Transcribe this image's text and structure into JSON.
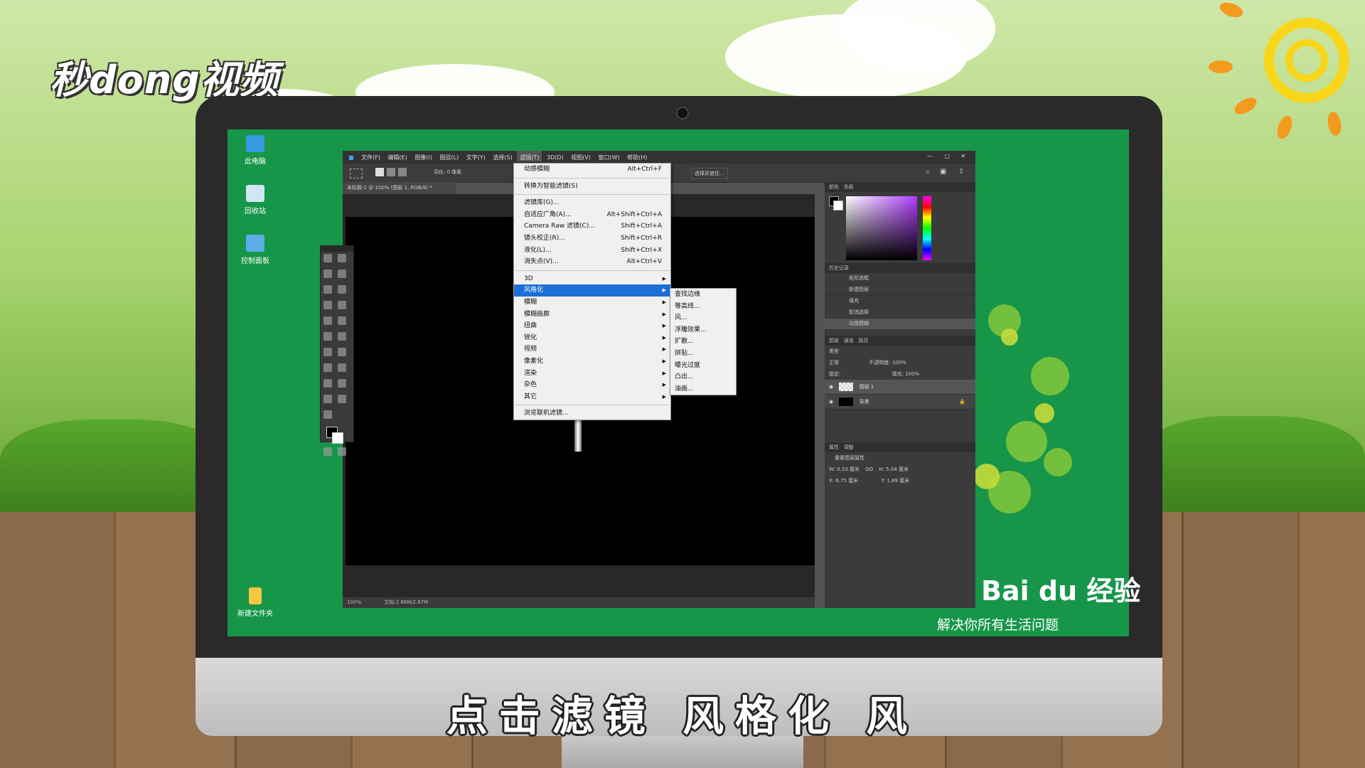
{
  "branding": {
    "logo_text": "秒dong视频",
    "baidu_logo": "Bai du 经验",
    "baidu_slogan": "解决你所有生活问题"
  },
  "subtitle": "点击滤镜 风格化 风",
  "desktop": {
    "icons": [
      {
        "label": "此电脑",
        "icon": "computer-icon"
      },
      {
        "label": "回收站",
        "icon": "recycle-bin-icon"
      },
      {
        "label": "控制面板",
        "icon": "control-panel-icon"
      },
      {
        "label": "新建文件夹",
        "icon": "folder-icon"
      }
    ]
  },
  "photoshop": {
    "menubar": [
      "文件(F)",
      "编辑(E)",
      "图像(I)",
      "图层(L)",
      "文字(Y)",
      "选择(S)",
      "滤镜(T)",
      "3D(D)",
      "视图(V)",
      "窗口(W)",
      "帮助(H)"
    ],
    "window_controls": [
      "—",
      "□",
      "✕"
    ],
    "options": {
      "feather": "羽化: 0 像素",
      "select_mask": "选择并遮住..."
    },
    "doc_tab": "未标题-1 @ 100% (图层 1, RGB/8) *",
    "status": {
      "zoom": "100%",
      "doc_size": "文档:2.86M/2.67M"
    },
    "panels": {
      "color_tabs": [
        "颜色",
        "色板"
      ],
      "history_title": "历史记录",
      "history_items": [
        "矩形选框",
        "新建图层",
        "填充",
        "取消选择",
        "动感模糊"
      ],
      "layers_tabs": [
        "图层",
        "通道",
        "路径"
      ],
      "layers_kind": "类型",
      "blend_mode": "正常",
      "opacity": "不透明度: 100%",
      "lock": "锁定:",
      "fill": "填充: 100%",
      "layers": [
        {
          "name": "图层 1"
        },
        {
          "name": "背景"
        }
      ],
      "properties_tabs": [
        "属性",
        "调整"
      ],
      "properties_title": "像素图层属性",
      "prop_w": "W: 0.33 厘米",
      "prop_h": "H: 5.04 厘米",
      "prop_x": "X: 6.75 厘米",
      "prop_y": "Y: 1.89 厘米",
      "link": "GO"
    },
    "filter_menu": {
      "top": [
        {
          "label": "动感模糊",
          "shortcut": "Alt+Ctrl+F"
        }
      ],
      "group2": [
        {
          "label": "转换为智能滤镜(S)",
          "shortcut": ""
        }
      ],
      "group3": [
        {
          "label": "滤镜库(G)...",
          "shortcut": ""
        },
        {
          "label": "自适应广角(A)...",
          "shortcut": "Alt+Shift+Ctrl+A"
        },
        {
          "label": "Camera Raw 滤镜(C)...",
          "shortcut": "Shift+Ctrl+A"
        },
        {
          "label": "镜头校正(R)...",
          "shortcut": "Shift+Ctrl+R"
        },
        {
          "label": "液化(L)...",
          "shortcut": "Shift+Ctrl+X"
        },
        {
          "label": "消失点(V)...",
          "shortcut": "Alt+Ctrl+V"
        }
      ],
      "submenus": [
        "3D",
        "风格化",
        "模糊",
        "模糊画廊",
        "扭曲",
        "锐化",
        "视频",
        "像素化",
        "渲染",
        "杂色",
        "其它"
      ],
      "highlighted": "风格化",
      "bottom": "浏览联机滤镜..."
    },
    "stylize_menu": [
      "查找边缘",
      "等高线...",
      "风...",
      "浮雕效果...",
      "扩散...",
      "拼贴...",
      "曝光过度",
      "凸出...",
      "油画..."
    ]
  }
}
